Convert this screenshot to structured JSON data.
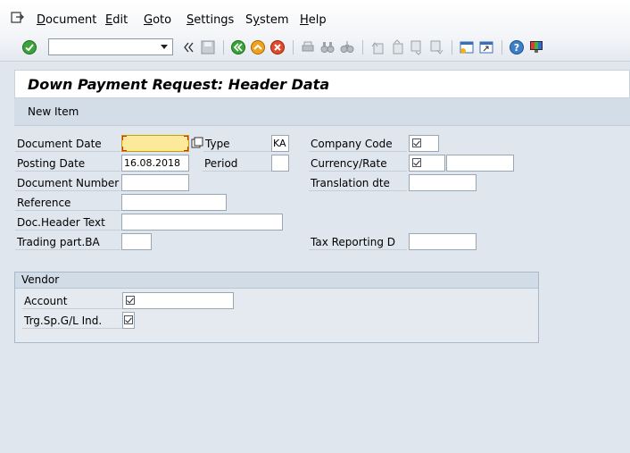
{
  "menu": [
    "Document",
    "Edit",
    "Goto",
    "Settings",
    "System",
    "Help"
  ],
  "menu_mnemonic": [
    "D",
    "E",
    "G",
    "S",
    "y",
    "H"
  ],
  "toolbar": {
    "command_value": "",
    "icons": [
      "enter-icon",
      "back-nav-icon",
      "save-icon",
      "back-icon",
      "exit-icon",
      "cancel-icon",
      "print-icon",
      "find-icon",
      "find-next-icon",
      "first-page-icon",
      "previous-page-icon",
      "next-page-icon",
      "last-page-icon",
      "new-session-icon",
      "shortcut-icon",
      "help-icon",
      "customize-layout-icon"
    ]
  },
  "screen": {
    "title": "Down Payment Request: Header Data",
    "new_item_label": "New Item"
  },
  "fields": {
    "document_date": {
      "label": "Document Date",
      "value": ""
    },
    "type": {
      "label": "Type",
      "value": "KA"
    },
    "company_code": {
      "label": "Company Code",
      "value": ""
    },
    "posting_date": {
      "label": "Posting Date",
      "value": "16.08.2018"
    },
    "period": {
      "label": "Period",
      "value": ""
    },
    "currency_rate": {
      "label": "Currency/Rate",
      "value": "",
      "rate": ""
    },
    "document_number": {
      "label": "Document Number",
      "value": ""
    },
    "translation_date": {
      "label": "Translation dte",
      "value": ""
    },
    "reference": {
      "label": "Reference",
      "value": ""
    },
    "doc_header_text": {
      "label": "Doc.Header Text",
      "value": ""
    },
    "trading_part_ba": {
      "label": "Trading part.BA",
      "value": ""
    },
    "tax_reporting_date": {
      "label": "Tax Reporting D",
      "value": ""
    }
  },
  "vendor": {
    "title": "Vendor",
    "account": {
      "label": "Account",
      "value": ""
    },
    "special_gl": {
      "label": "Trg.Sp.G/L Ind.",
      "value": ""
    }
  },
  "colors": {
    "required_field": "#fce99a",
    "background": "#dfe6ee",
    "title_background": "#ffffff"
  }
}
